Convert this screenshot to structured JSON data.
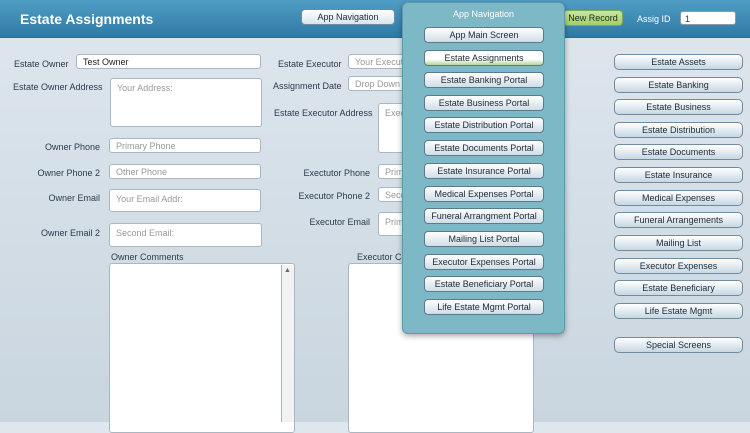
{
  "header": {
    "title": "Estate Assignments",
    "app_nav_label": "App Navigation",
    "new_record_label": "New Record",
    "assig_id_label": "Assig ID",
    "assig_id_value": "1"
  },
  "owner": {
    "estate_owner_label": "Estate Owner",
    "estate_owner_value": "Test Owner",
    "address_label": "Estate Owner Address",
    "address_placeholder": "Your Address:",
    "phone_label": "Owner Phone",
    "phone_placeholder": "Primary Phone",
    "phone2_label": "Owner Phone 2",
    "phone2_placeholder": "Other Phone",
    "email_label": "Owner Email",
    "email_placeholder": "Your Email Addr:",
    "email2_label": "Owner Email 2",
    "email2_placeholder": "Second Email:",
    "comments_label": "Owner Comments"
  },
  "executor": {
    "executor_label": "Estate Executor",
    "executor_placeholder": "Your Executor",
    "assignment_date_label": "Assignment Date",
    "assignment_date_placeholder": "Drop Down",
    "address_label": "Estate Executor Address",
    "address_placeholder": "Executor",
    "phone_label": "Exectutor Phone",
    "phone_placeholder": "Primary",
    "phone2_label": "Executor Phone 2",
    "phone2_placeholder": "Second",
    "email_label": "Executor Email",
    "email_placeholder": "Primary",
    "comments_label": "Executor Comments"
  },
  "popup": {
    "title": "App Navigation",
    "items": [
      "App Main Screen",
      "Estate Assignments",
      "Estate Banking Portal",
      "Estate Business Portal",
      "Estate Distribution Portal",
      "Estate Documents Portal",
      "Estate Insurance Portal",
      "Medical Expenses Portal",
      "Funeral Arrangment Portal",
      "Mailing List Portal",
      "Executor Expenses Portal",
      "Estate Beneficiary Portal",
      "Life Estate Mgmt Portal"
    ]
  },
  "right_nav": {
    "items": [
      "Estate Assets",
      "Estate Banking",
      "Estate Business",
      "Estate Distribution",
      "Estate Documents",
      "Estate Insurance",
      "Medical Expenses",
      "Funeral Arrangements",
      "Mailing List",
      "Executor Expenses",
      "Estate Beneficiary",
      "Life Estate Mgmt"
    ],
    "special": "Special Screens"
  }
}
